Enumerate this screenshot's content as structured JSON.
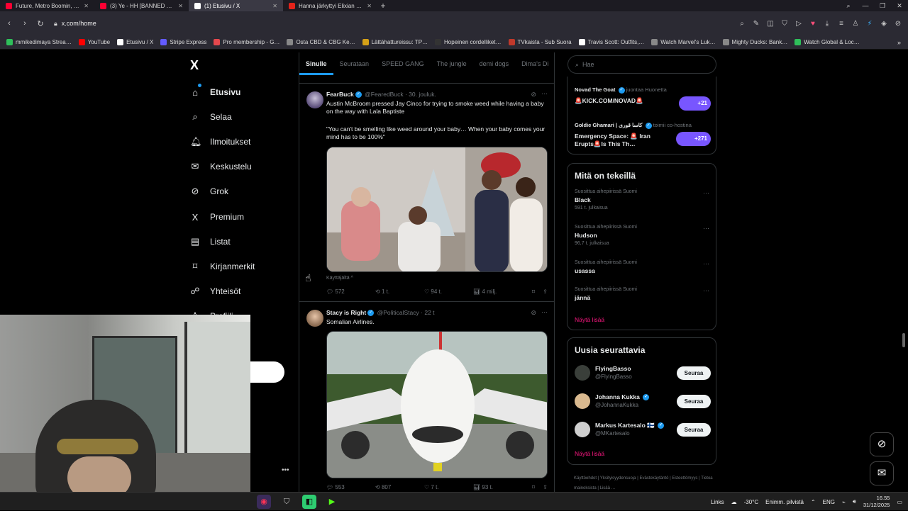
{
  "browser": {
    "tabs": [
      {
        "title": "Future, Metro Boomin, Tr…",
        "color": "#ff0033"
      },
      {
        "title": "(3) Ye - HH [BANNED TRA…",
        "color": "#ff0033"
      },
      {
        "title": "(1) Etusivu / X",
        "color": "#ffffff"
      },
      {
        "title": "Hanna järkyttyi Elixian oh…",
        "color": "#e2231a"
      }
    ],
    "new_tab": "+",
    "url": "x.com/home",
    "bookmarks": [
      {
        "label": "mmikedimaya Strea…",
        "color": "#2fbf5a"
      },
      {
        "label": "YouTube",
        "color": "#ff0000"
      },
      {
        "label": "Etusivu / X",
        "color": "#ffffff"
      },
      {
        "label": "Stripe Express",
        "color": "#635bff"
      },
      {
        "label": "Pro membership - G…",
        "color": "#e5484d"
      },
      {
        "label": "Osta CBD & CBG Ke…",
        "color": "#888888"
      },
      {
        "label": "Lättähattureissu: TP…",
        "color": "#d4a017"
      },
      {
        "label": "Hopeinen cordelliket…",
        "color": "#333333"
      },
      {
        "label": "TVkaista - Sub Suora",
        "color": "#c0392b"
      },
      {
        "label": "Travis Scott: Outfits,…",
        "color": "#ffffff"
      },
      {
        "label": "Watch Marvel's Luk…",
        "color": "#888888"
      },
      {
        "label": "Mighty Ducks: Bank…",
        "color": "#888888"
      },
      {
        "label": "Watch Global & Loc…",
        "color": "#2fbf5a"
      }
    ]
  },
  "x": {
    "logo": "X",
    "nav": [
      {
        "label": "Etusivu",
        "icon": "home-icon",
        "glyph": "⌂"
      },
      {
        "label": "Selaa",
        "icon": "search-icon",
        "glyph": "⌕"
      },
      {
        "label": "Ilmoitukset",
        "icon": "bell-icon",
        "glyph": "🔔︎"
      },
      {
        "label": "Keskustelu",
        "icon": "mail-icon",
        "glyph": "✉"
      },
      {
        "label": "Grok",
        "icon": "grok-icon",
        "glyph": "⊘"
      },
      {
        "label": "Premium",
        "icon": "x-premium-icon",
        "glyph": "X"
      },
      {
        "label": "Listat",
        "icon": "list-icon",
        "glyph": "▤"
      },
      {
        "label": "Kirjanmerkit",
        "icon": "bookmark-icon",
        "glyph": "⌑"
      },
      {
        "label": "Yhteisöt",
        "icon": "communities-icon",
        "glyph": "☍"
      },
      {
        "label": "Profiili",
        "icon": "profile-icon",
        "glyph": "♙"
      }
    ],
    "timeline_tabs": [
      "Sinulle",
      "Seurataan",
      "SPEED GANG",
      "The jungle",
      "demi dogs",
      "Dima's Di"
    ],
    "posts": [
      {
        "name": "FearBuck",
        "handle": "@FearedBuck",
        "time": "· 30. jouluk.",
        "text1": "Austin McBroom pressed Jay Cinco for trying to smoke weed while having a baby on the way with Lala Baptiste",
        "text2": "\"You can't be smelling like weed around your baby… When your baby comes your mind has to be 100%\"",
        "note": "Käyttäjältä ^",
        "replies": "572",
        "reposts": "1 t.",
        "likes": "94 t.",
        "views": "4 milj."
      },
      {
        "name": "Stacy is Right",
        "handle": "@PoliticalStacy",
        "time": "· 22 t",
        "text1": "Somalian Airlines.",
        "replies": "553",
        "reposts": "807",
        "likes": "7 t.",
        "views": "93 t."
      }
    ],
    "search_placeholder": "Hae",
    "spaces": [
      {
        "host": "Novad The Goat",
        "role": "juontaa Huonetta",
        "title": "🚨KICK.COM/NOVAD🚨",
        "count": "+21"
      },
      {
        "host": "Goldie Ghamari | كاسا قوری",
        "role": "toimii co-hostina",
        "title": "Emergency Space: 🚨 Iran Erupts🚨Is This Th…",
        "count": "+271"
      }
    ],
    "trends_title": "Mitä on tekeillä",
    "trends": [
      {
        "context": "Suosittua aihepiirissä Suomi",
        "name": "Black",
        "count": "591 t. julkaisua"
      },
      {
        "context": "Suosittua aihepiirissä Suomi",
        "name": "Hudson",
        "count": "96,7 t. julkaisua"
      },
      {
        "context": "Suosittua aihepiirissä Suomi",
        "name": "usassa",
        "count": ""
      },
      {
        "context": "Suosittua aihepiirissä Suomi",
        "name": "jännä",
        "count": ""
      }
    ],
    "show_more": "Näytä lisää",
    "who_title": "Uusia seurattavia",
    "who": [
      {
        "name": "FlyingBasso",
        "handle": "@FlyingBasso",
        "verified": false,
        "follow": "Seuraa"
      },
      {
        "name": "Johanna Kukka",
        "handle": "@JohannaKukka",
        "verified": true,
        "follow": "Seuraa"
      },
      {
        "name": "Markus Kartesalo 🇫🇮",
        "handle": "@MKartesalo",
        "verified": true,
        "follow": "Seuraa"
      }
    ],
    "footer": [
      "Käyttöehdot",
      "Yksityisyydensuoja",
      "Evästekäytäntö",
      "Esteettömyys",
      "Tietoa mainoksista",
      "Lisää …"
    ]
  },
  "taskbar": {
    "links": "Links",
    "temp": "-30°C",
    "weather": "Enimm. pilvistä",
    "lang": "ENG",
    "time": "16.55",
    "date": "31/12/2025"
  }
}
